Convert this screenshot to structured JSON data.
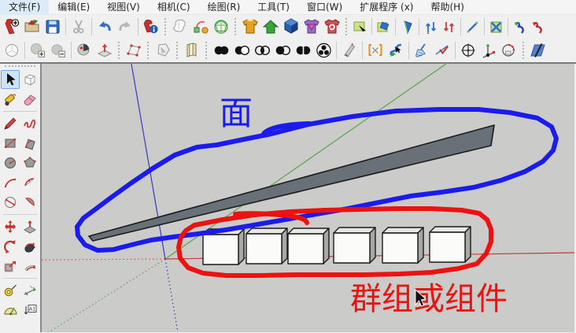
{
  "menubar": {
    "items": [
      {
        "label": "文件(F)"
      },
      {
        "label": "编辑(E)"
      },
      {
        "label": "视图(V)"
      },
      {
        "label": "相机(C)"
      },
      {
        "label": "绘图(R)"
      },
      {
        "label": "工具(T)"
      },
      {
        "label": "窗口(W)"
      },
      {
        "label": "扩展程序 (x)"
      },
      {
        "label": "帮助(H)"
      }
    ]
  },
  "toolbar_row1": {
    "icons": [
      "new",
      "open",
      "save",
      "cut",
      "undo",
      "redo",
      "model-info",
      "outline-blob",
      "arc-path",
      "geodesic-sphere",
      "component-orange-shirt",
      "component-green-house",
      "component-blue-cube",
      "component-purple-shirt",
      "component-red-swirl",
      "tag-black-arrow",
      "tag-blue",
      "triangle-blue",
      "arrows-up-down-blue",
      "arrows-up-down-red",
      "segment-blue",
      "cross-blue-green",
      "curve-arrow-blue",
      "curve-arrow-red"
    ]
  },
  "toolbar_row2": {
    "icons": [
      "sphere-outline",
      "sphere-add",
      "sphere-subtract",
      "sphere-dot",
      "plane-up-arrow",
      "quad-points",
      "polygon-gray",
      "striped-pages",
      "solid-outer-shell",
      "solid-intersect",
      "solid-union",
      "solid-subtract",
      "solid-trim",
      "solid-split",
      "pencil-bar",
      "brackets-x",
      "s-curve-select",
      "clean-broom",
      "check-edge",
      "circle-crosshair",
      "axis-pin",
      "circle-red-arc",
      "square-slash"
    ]
  },
  "sidebar": {
    "active_tool": "select",
    "text_badge": "A1",
    "tools": [
      "select",
      "make-component",
      "paint-bucket",
      "eraser",
      "line",
      "freehand",
      "rectangle",
      "rotated-rectangle",
      "circle",
      "polygon",
      "arc",
      "two-point-arc",
      "three-point-arc",
      "pie",
      "move",
      "push-pull",
      "rotate",
      "follow-me",
      "scale",
      "offset",
      "tape-measure",
      "dimensions",
      "protractor",
      "text"
    ]
  },
  "viewport": {
    "background": "#cbcbc9",
    "labels": {
      "face": "面",
      "group": "群组或组件"
    },
    "annotation_colors": {
      "blue": "#1b1bee",
      "red": "#ec1212"
    },
    "axis_colors": {
      "red": "#c03a3a",
      "green": "#54a848",
      "blue": "#3939c8"
    },
    "model": {
      "face_color": "#687078",
      "group_box_count": 6
    }
  }
}
